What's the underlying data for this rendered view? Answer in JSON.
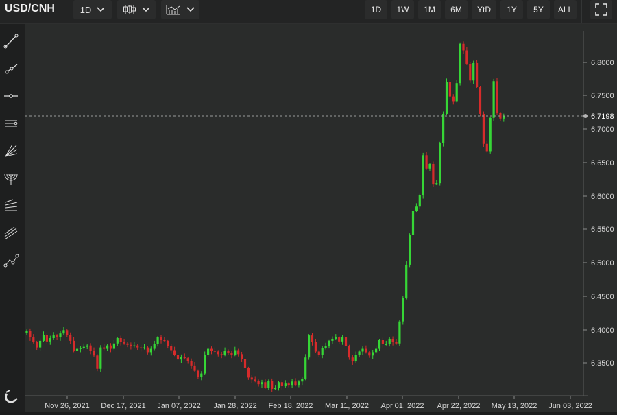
{
  "header": {
    "symbol": "USD/CNH",
    "interval": "1D",
    "ranges": [
      "1D",
      "1W",
      "1M",
      "6M",
      "YtD",
      "1Y",
      "5Y",
      "ALL"
    ]
  },
  "icons": {
    "interval_caret": "chevron-down-icon",
    "chart_type": "candlestick-icon",
    "indicators": "indicators-icon",
    "fullscreen": "fullscreen-icon",
    "tools": [
      "trend-line-icon",
      "ray-icon",
      "horizontal-line-icon",
      "channel-icon",
      "fan-icon",
      "arc-icon",
      "fib-retracement-icon",
      "parallel-lines-icon",
      "path-icon"
    ],
    "magnet": "magnet-icon"
  },
  "colors": {
    "up": "#36d636",
    "down": "#d62b2b",
    "background": "#2a2c2b"
  },
  "chart_data": {
    "type": "candlestick",
    "ylim": [
      6.305,
      6.845
    ],
    "y_ticks": [
      "6.8000",
      "6.7500",
      "6.7000",
      "6.6500",
      "6.6000",
      "6.5500",
      "6.5000",
      "6.4500",
      "6.4000",
      "6.3500"
    ],
    "x_ticks": [
      "Nov 26, 2021",
      "Dec 17, 2021",
      "Jan 07, 2022",
      "Jan 28, 2022",
      "Feb 18, 2022",
      "Mar 11, 2022",
      "Apr 01, 2022",
      "Apr 22, 2022",
      "May 13, 2022",
      "Jun 03, 2022"
    ],
    "last_price": "6.7198",
    "grid": false,
    "close": [
      6.398,
      6.388,
      6.381,
      6.373,
      6.383,
      6.392,
      6.382,
      6.387,
      6.391,
      6.388,
      6.394,
      6.399,
      6.392,
      6.383,
      6.368,
      6.371,
      6.372,
      6.374,
      6.376,
      6.368,
      6.361,
      6.341,
      6.373,
      6.371,
      6.376,
      6.371,
      6.379,
      6.387,
      6.381,
      6.379,
      6.377,
      6.375,
      6.376,
      6.373,
      6.372,
      6.373,
      6.366,
      6.371,
      6.378,
      6.388,
      6.384,
      6.383,
      6.375,
      6.369,
      6.362,
      6.355,
      6.359,
      6.357,
      6.353,
      6.346,
      6.338,
      6.329,
      6.334,
      6.362,
      6.371,
      6.368,
      6.367,
      6.363,
      6.362,
      6.368,
      6.365,
      6.362,
      6.369,
      6.363,
      6.356,
      6.342,
      6.328,
      6.325,
      6.323,
      6.318,
      6.321,
      6.313,
      6.323,
      6.311,
      6.312,
      6.321,
      6.315,
      6.319,
      6.317,
      6.322,
      6.317,
      6.322,
      6.326,
      6.358,
      6.391,
      6.381,
      6.367,
      6.362,
      6.372,
      6.375,
      6.383,
      6.386,
      6.388,
      6.382,
      6.388,
      6.375,
      6.358,
      6.352,
      6.362,
      6.367,
      6.371,
      6.366,
      6.361,
      6.366,
      6.371,
      6.384,
      6.378,
      6.378,
      6.386,
      6.381,
      6.379,
      6.412,
      6.447,
      6.497,
      6.542,
      6.578,
      6.584,
      6.601,
      6.661,
      6.641,
      6.648,
      6.618,
      6.619,
      6.679,
      6.723,
      6.771,
      6.749,
      6.742,
      6.769,
      6.828,
      6.818,
      6.798,
      6.773,
      6.799,
      6.763,
      6.723,
      6.678,
      6.667,
      6.717,
      6.772,
      6.724,
      6.716,
      6.7198
    ]
  }
}
